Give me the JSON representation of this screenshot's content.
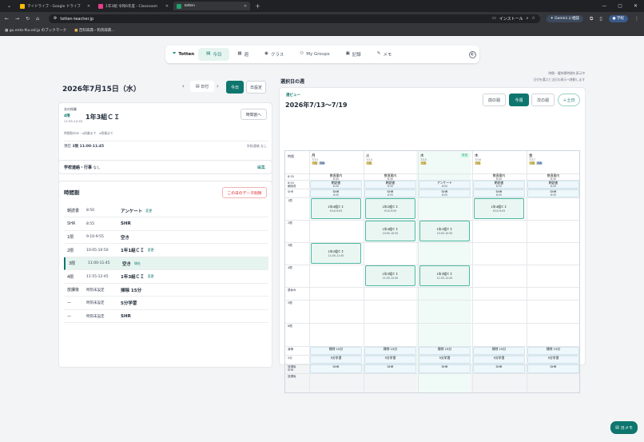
{
  "browser": {
    "tabs": [
      {
        "title": "マイドライブ - Google ドライブ",
        "color": "#fbbc04"
      },
      {
        "title": "1年3組 令和6年度 - Classroom",
        "color": "#e83e8c"
      },
      {
        "title": "Totten",
        "color": "#22a06b",
        "active": true
      }
    ],
    "url": "totten-teacher.jp",
    "install_label": "インストール",
    "gemini_label": "Gemini に相談",
    "profile_label": "学校",
    "bookmarks": [
      "gu.ento-fku.ed.jp のブックマーク",
      "百科辞典・和英辞典…"
    ]
  },
  "nav": {
    "brand": "Totten",
    "items": [
      {
        "label": "今日",
        "icon": "calendar-icon",
        "active": true
      },
      {
        "label": "週",
        "icon": "grid-icon"
      },
      {
        "label": "クラス",
        "icon": "eye-icon"
      },
      {
        "label": "My Groups",
        "icon": "users-icon"
      },
      {
        "label": "記録",
        "icon": "record-icon"
      },
      {
        "label": "メモ",
        "icon": "memo-icon"
      }
    ]
  },
  "hints": {
    "line1": "時間・曜休憩時間を表示中",
    "line2": "日付を選ぶと当日の表示へ移動します"
  },
  "today": {
    "date": "2026年7月15日（水）",
    "date_picker_label": "日付",
    "today_button": "今日",
    "settings_button": "日設定",
    "next_label": "次の授業",
    "next_period": "4限",
    "next_time": "11:55-12:45",
    "next_class": "1年3組ＣＩ",
    "next_status": "時間割のみ・a授業まで　a授業まで",
    "time_button": "時間割へ",
    "current_label": "現在",
    "current_value": "3限 11:00-11:45",
    "current_note": "学校連絡 なし",
    "contact_label": "学校連絡・行事",
    "contact_value": "なし",
    "edit_label": "編集"
  },
  "timetable": {
    "title": "時間割",
    "delete_button": "この日のデータ削除",
    "rows": [
      {
        "period": "朝読書",
        "time": "8:50",
        "subject": "アンケート",
        "tag": "変更"
      },
      {
        "period": "SHR",
        "time": "8:55",
        "subject": "SHR",
        "tag": ""
      },
      {
        "period": "1限",
        "time": "9:10-9:55",
        "subject": "空き",
        "tag": ""
      },
      {
        "period": "2限",
        "time": "10:05-10:50",
        "subject": "1年1組ＣＩ",
        "tag": "変更"
      },
      {
        "period": "3限",
        "time": "11:00-11:45",
        "subject": "空き",
        "tag": "現在",
        "current": true
      },
      {
        "period": "4限",
        "time": "11:55-12:45",
        "subject": "1年3組ＣＩ",
        "tag": "変更"
      },
      {
        "period": "放課後",
        "time": "時刻未設定",
        "subject": "掃除 15分",
        "tag": ""
      },
      {
        "period": "—",
        "time": "時刻未設定",
        "subject": "5分学習",
        "tag": ""
      },
      {
        "period": "—",
        "time": "時刻未設定",
        "subject": "SHR",
        "tag": ""
      }
    ]
  },
  "week": {
    "title": "選択日の週",
    "view_label": "週ビュー",
    "range": "2026年7/13〜7/19",
    "prev_button": "前の週",
    "this_button": "今週",
    "next_button": "次の週",
    "weekend_button": "＋土日",
    "period_header": "時限",
    "days": [
      {
        "name": "月",
        "date": "7/13",
        "tags": [
          "日直",
          "週番"
        ]
      },
      {
        "name": "火",
        "date": "7/14",
        "tags": [
          "日直"
        ]
      },
      {
        "name": "水",
        "date": "7/15",
        "tags": [
          "日直"
        ],
        "today_label": "今日"
      },
      {
        "name": "木",
        "date": "7/16",
        "tags": [
          "日直"
        ]
      },
      {
        "name": "金",
        "date": "7/17",
        "tags": [
          "日直",
          "週番"
        ]
      }
    ],
    "row_labels": [
      "8:30",
      "8:50\n朝読書",
      "SHR",
      "1限",
      "2限",
      "3限",
      "4限",
      "昼休み",
      "5限",
      "6限",
      "清掃",
      "5分",
      "放課後\nSHR",
      "放課後"
    ],
    "cells": [
      {
        "row": 0,
        "day": 0,
        "text": "数直案内",
        "sub": "8:30"
      },
      {
        "row": 0,
        "day": 1,
        "text": "数直案内",
        "sub": "8:30"
      },
      {
        "row": 0,
        "day": 3,
        "text": "数直案内",
        "sub": "8:30"
      },
      {
        "row": 0,
        "day": 4,
        "text": "数直案内",
        "sub": "8:30"
      },
      {
        "row": 1,
        "day": 0,
        "text": "朝読書",
        "sub": "8:50"
      },
      {
        "row": 1,
        "day": 1,
        "text": "朝読書",
        "sub": "8:50"
      },
      {
        "row": 1,
        "day": 2,
        "text": "アンケート",
        "sub": "8:50"
      },
      {
        "row": 1,
        "day": 3,
        "text": "朝読書",
        "sub": "8:50"
      },
      {
        "row": 1,
        "day": 4,
        "text": "朝読書",
        "sub": "8:50"
      },
      {
        "row": 2,
        "day": 0,
        "text": "SHR",
        "sub": "8:55"
      },
      {
        "row": 2,
        "day": 1,
        "text": "SHR",
        "sub": "8:55"
      },
      {
        "row": 2,
        "day": 2,
        "text": "SHR",
        "sub": "8:55"
      },
      {
        "row": 2,
        "day": 3,
        "text": "SHR",
        "sub": "8:55"
      },
      {
        "row": 2,
        "day": 4,
        "text": "SHR",
        "sub": "8:55"
      },
      {
        "row": 3,
        "day": 0,
        "text": "1年4組ＣＩ",
        "sub": "9:10-9:55",
        "lesson": true
      },
      {
        "row": 3,
        "day": 1,
        "text": "1年2組ＣＩ",
        "sub": "9:10-9:55",
        "lesson": true
      },
      {
        "row": 3,
        "day": 3,
        "text": "1年4組ＣＩ",
        "sub": "9:10-9:55",
        "lesson": true
      },
      {
        "row": 4,
        "day": 1,
        "text": "1年4組ＣＩ",
        "sub": "10:05-10:50",
        "lesson": true
      },
      {
        "row": 4,
        "day": 2,
        "text": "1年1組ＣＩ",
        "sub": "10:05-10:50",
        "lesson": true
      },
      {
        "row": 5,
        "day": 0,
        "text": "1年2組ＣＩ",
        "sub": "11:00-11:45",
        "lesson": true
      },
      {
        "row": 6,
        "day": 1,
        "text": "1年3組ＣＩ",
        "sub": "11:55-12:45",
        "lesson": true
      },
      {
        "row": 6,
        "day": 2,
        "text": "1年3組ＣＩ",
        "sub": "11:55-12:45",
        "lesson": true
      },
      {
        "row": 10,
        "day": 0,
        "text": "掃除 15分"
      },
      {
        "row": 10,
        "day": 1,
        "text": "掃除 15分"
      },
      {
        "row": 10,
        "day": 2,
        "text": "掃除 15分"
      },
      {
        "row": 10,
        "day": 3,
        "text": "掃除 15分"
      },
      {
        "row": 10,
        "day": 4,
        "text": "掃除 15分"
      },
      {
        "row": 11,
        "day": 0,
        "text": "5分学習"
      },
      {
        "row": 11,
        "day": 1,
        "text": "5分学習"
      },
      {
        "row": 11,
        "day": 2,
        "text": "5分学習"
      },
      {
        "row": 11,
        "day": 3,
        "text": "5分学習"
      },
      {
        "row": 11,
        "day": 4,
        "text": "5分学習"
      },
      {
        "row": 12,
        "day": 0,
        "text": "SHR"
      },
      {
        "row": 12,
        "day": 1,
        "text": "SHR"
      },
      {
        "row": 12,
        "day": 2,
        "text": "SHR"
      },
      {
        "row": 12,
        "day": 3,
        "text": "SHR"
      },
      {
        "row": 12,
        "day": 4,
        "text": "SHR"
      }
    ]
  },
  "fab_label": "日メモ",
  "colors": {
    "accent": "#0f766e",
    "lesson_fill": "#e9f6f2",
    "today_column": "#f0faf6"
  }
}
